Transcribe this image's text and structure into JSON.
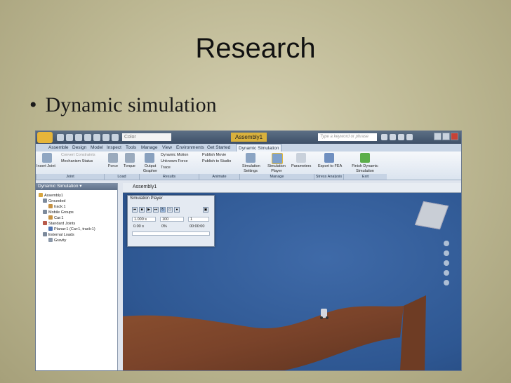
{
  "slide": {
    "title": "Research",
    "bullet_marker": "•",
    "bullet": "Dynamic simulation"
  },
  "app": {
    "color_box": "Color",
    "document_title": "Assembly1",
    "search_placeholder": "Type a keyword or phrase",
    "tabs": [
      "Assemble",
      "Design",
      "Model",
      "Inspect",
      "Tools",
      "Manage",
      "View",
      "Environments",
      "Get Started",
      "Dynamic Simulation"
    ],
    "active_tab": "Dynamic Simulation",
    "ribbon": {
      "insert_joint": "Insert Joint",
      "convert_constraints": "Convert Constraints",
      "mechanism_status": "Mechanism Status",
      "force": "Force",
      "torque": "Torque",
      "output_grapher": "Output Grapher",
      "dynamic_motion": "Dynamic Motion",
      "unknown_force": "Unknown Force",
      "trace": "Trace",
      "publish_movie": "Publish Movie",
      "publish_to_studio": "Publish to Studio",
      "simulation_settings": "Simulation Settings",
      "simulation_player": "Simulation Player",
      "parameters": "Parameters",
      "export_to_fea": "Export to FEA",
      "finish": "Finish Dynamic Simulation"
    },
    "groups": {
      "joint": "Joint",
      "load": "Load",
      "results": "Results",
      "animate": "Animate",
      "manage": "Manage",
      "stress_analysis": "Stress Analysis",
      "exit": "Exit"
    },
    "browser": {
      "header": "Dynamic Simulation ▾",
      "tree": [
        "Assembly1",
        "Grounded",
        "track:1",
        "Mobile Groups",
        "Car:1",
        "Standard Joints",
        "Planar:1 (Car:1, track:1)",
        "External Loads",
        "Gravity"
      ]
    },
    "viewport_title": "Assembly1",
    "player": {
      "title": "Simulation Player",
      "final_time": "1.000 s",
      "images": "100",
      "filter": "1",
      "current_time": "0.00 s",
      "percent": "0%",
      "elapsed": "00:00:00"
    }
  }
}
